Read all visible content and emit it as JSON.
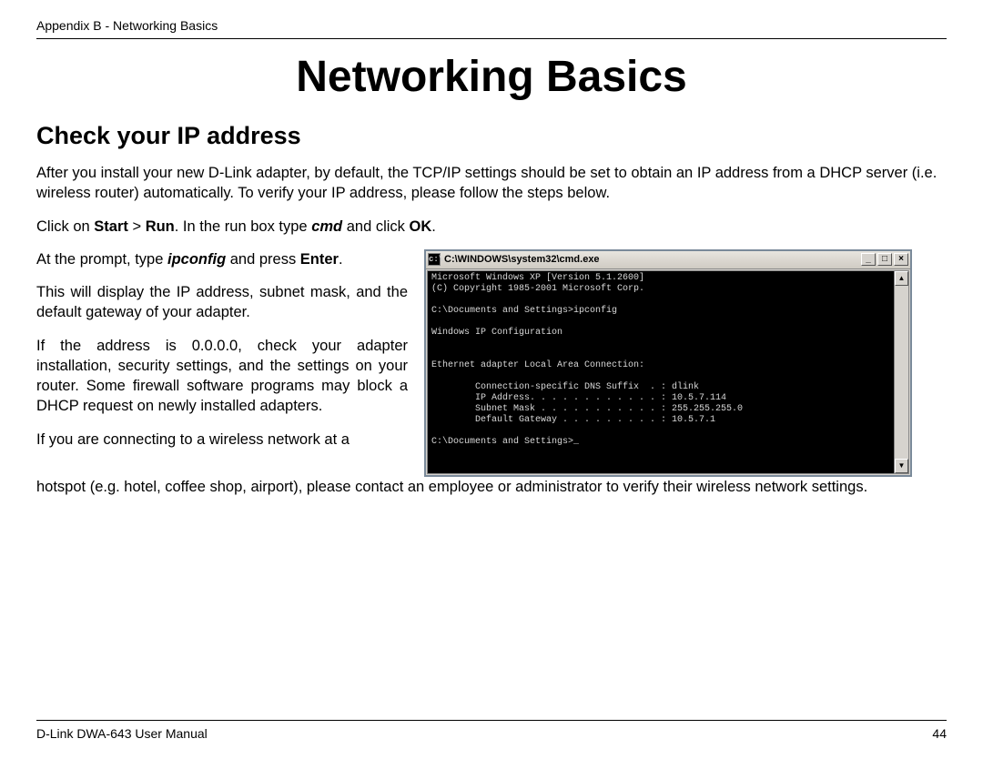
{
  "header": "Appendix B - Networking Basics",
  "title": "Networking Basics",
  "subtitle": "Check your IP address",
  "intro": "After you install your new D-Link adapter, by default, the TCP/IP settings should be set to obtain an IP address from a DHCP server (i.e. wireless router) automatically. To verify your IP address, please follow the steps below.",
  "step1_pre": "Click on ",
  "step1_b1": "Start",
  "step1_gt": " > ",
  "step1_b2": "Run",
  "step1_mid": ". In the run box type ",
  "step1_cmd": "cmd",
  "step1_post1": " and click ",
  "step1_b3": "OK",
  "step1_post2": ".",
  "step2_pre": "At the prompt, type ",
  "step2_cmd": "ipconfig",
  "step2_mid": " and press ",
  "step2_b": "Enter",
  "step2_post": ".",
  "para3": "This will display the IP address, subnet mask, and the default gateway of your adapter.",
  "para4": "If the address is 0.0.0.0, check your adapter installation, security settings, and the settings on your router. Some firewall software programs may block a DHCP request on newly installed adapters.",
  "para5a": "If you are connecting to a wireless network at a",
  "para5b": "hotspot (e.g. hotel, coffee shop, airport), please contact an employee or administrator to verify their wireless network settings.",
  "cmd": {
    "title": "C:\\WINDOWS\\system32\\cmd.exe",
    "min": "_",
    "max": "□",
    "close": "×",
    "up": "▲",
    "down": "▼",
    "output": "Microsoft Windows XP [Version 5.1.2600]\n(C) Copyright 1985-2001 Microsoft Corp.\n\nC:\\Documents and Settings>ipconfig\n\nWindows IP Configuration\n\n\nEthernet adapter Local Area Connection:\n\n        Connection-specific DNS Suffix  . : dlink\n        IP Address. . . . . . . . . . . . : 10.5.7.114\n        Subnet Mask . . . . . . . . . . . : 255.255.255.0\n        Default Gateway . . . . . . . . . : 10.5.7.1\n\nC:\\Documents and Settings>_"
  },
  "footer_left": "D-Link DWA-643 User Manual",
  "footer_right": "44"
}
